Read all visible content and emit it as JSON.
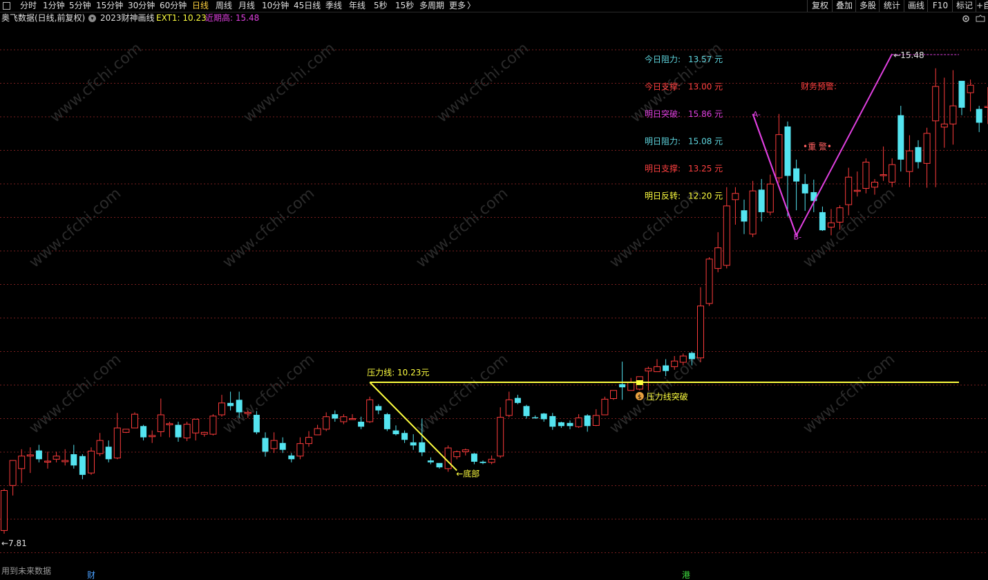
{
  "toolbar": {
    "periods": [
      "分时",
      "1分钟",
      "5分钟",
      "15分钟",
      "30分钟",
      "60分钟",
      "日线",
      "周线",
      "月线",
      "10分钟",
      "45日线",
      "季线",
      "年线",
      "5秒",
      "15秒",
      "多周期",
      "更多"
    ],
    "active_period": "日线",
    "more_arrow": "〉",
    "tools": [
      "复权",
      "叠加",
      "多股",
      "统计",
      "画线",
      "F10",
      "标记",
      "+自"
    ]
  },
  "info": {
    "stock": "奥飞数据(日线,前复权)",
    "indicator": "2023财神画线",
    "ext_label": "EXT1: 10.23",
    "recent_high_label": "近期高: 15.48"
  },
  "panel": {
    "rows": [
      {
        "label": "今日阻力:",
        "value": "13.57 元",
        "color": "#5fd7e0"
      },
      {
        "label": "今日支撑:",
        "value": "13.00 元",
        "color": "#ff4040"
      },
      {
        "label": "明日突破:",
        "value": "15.86 元",
        "color": "#e040e0"
      },
      {
        "label": "明日阻力:",
        "value": "15.08 元",
        "color": "#5fd7e0"
      },
      {
        "label": "明日支撑:",
        "value": "13.25 元",
        "color": "#ff4040"
      },
      {
        "label": "明日反转:",
        "value": "12.20 元",
        "color": "#ffff40"
      }
    ],
    "warning": "财务预警:",
    "alert": "•重 警•"
  },
  "annotations": {
    "pressure_line": "压力线: 10.23元",
    "bottom": "←底部",
    "breakthrough": "压力线突破",
    "low_label": "←7.81",
    "high_label": "←15.48",
    "point_a": "A-",
    "point_b": "B-",
    "coin": "$"
  },
  "footer": {
    "note": "用到未来数据",
    "marker_1": "财",
    "marker_2": "港"
  },
  "watermark": "www.cfchi.com",
  "colors": {
    "up": "#ff3c3c",
    "down": "#54e4f0",
    "grid": "#7a1f1f",
    "pressure": "#ffff40",
    "zigzag": "#e040e0"
  },
  "chart_data": {
    "type": "candlestick",
    "title": "奥飞数据(日线,前复权)",
    "ylim": [
      7.5,
      15.9
    ],
    "pressure_level": 10.23,
    "recent_high": 15.48,
    "low_marker": 7.81,
    "candles": [
      {
        "o": 7.86,
        "h": 8.53,
        "l": 7.81,
        "c": 8.5
      },
      {
        "o": 8.58,
        "h": 8.92,
        "l": 8.42,
        "c": 8.98
      },
      {
        "o": 8.85,
        "h": 9.16,
        "l": 8.62,
        "c": 9.05
      },
      {
        "o": 9.05,
        "h": 9.19,
        "l": 8.78,
        "c": 9.07
      },
      {
        "o": 9.14,
        "h": 9.23,
        "l": 8.95,
        "c": 9.0
      },
      {
        "o": 8.97,
        "h": 9.12,
        "l": 8.85,
        "c": 8.97
      },
      {
        "o": 9.0,
        "h": 9.12,
        "l": 8.95,
        "c": 9.05
      },
      {
        "o": 8.96,
        "h": 9.16,
        "l": 8.9,
        "c": 8.98
      },
      {
        "o": 9.08,
        "h": 9.23,
        "l": 8.85,
        "c": 8.9
      },
      {
        "o": 9.05,
        "h": 9.08,
        "l": 8.68,
        "c": 8.75
      },
      {
        "o": 8.78,
        "h": 9.19,
        "l": 8.75,
        "c": 9.13
      },
      {
        "o": 9.09,
        "h": 9.42,
        "l": 9.05,
        "c": 9.3
      },
      {
        "o": 9.2,
        "h": 9.3,
        "l": 8.95,
        "c": 9.0
      },
      {
        "o": 9.02,
        "h": 9.74,
        "l": 9.0,
        "c": 9.5
      },
      {
        "o": 9.43,
        "h": 9.48,
        "l": 9.42,
        "c": 9.48
      },
      {
        "o": 9.5,
        "h": 9.75,
        "l": 9.5,
        "c": 9.72
      },
      {
        "o": 9.53,
        "h": 9.55,
        "l": 9.3,
        "c": 9.35
      },
      {
        "o": 9.36,
        "h": 9.46,
        "l": 9.26,
        "c": 9.38
      },
      {
        "o": 9.44,
        "h": 9.97,
        "l": 9.36,
        "c": 9.71
      },
      {
        "o": 9.55,
        "h": 9.6,
        "l": 9.35,
        "c": 9.57
      },
      {
        "o": 9.55,
        "h": 9.6,
        "l": 9.28,
        "c": 9.35
      },
      {
        "o": 9.34,
        "h": 9.6,
        "l": 9.29,
        "c": 9.56
      },
      {
        "o": 9.42,
        "h": 9.64,
        "l": 9.3,
        "c": 9.64
      },
      {
        "o": 9.4,
        "h": 9.44,
        "l": 9.36,
        "c": 9.43
      },
      {
        "o": 9.4,
        "h": 9.72,
        "l": 9.38,
        "c": 9.69
      },
      {
        "o": 9.71,
        "h": 10.03,
        "l": 9.68,
        "c": 9.9
      },
      {
        "o": 9.9,
        "h": 10.08,
        "l": 9.78,
        "c": 9.85
      },
      {
        "o": 9.95,
        "h": 10.08,
        "l": 9.66,
        "c": 9.75
      },
      {
        "o": 9.73,
        "h": 9.78,
        "l": 9.66,
        "c": 9.75
      },
      {
        "o": 9.71,
        "h": 9.77,
        "l": 9.4,
        "c": 9.43
      },
      {
        "o": 9.34,
        "h": 9.43,
        "l": 9.04,
        "c": 9.12
      },
      {
        "o": 9.17,
        "h": 9.43,
        "l": 9.1,
        "c": 9.3
      },
      {
        "o": 9.26,
        "h": 9.35,
        "l": 9.1,
        "c": 9.15
      },
      {
        "o": 9.06,
        "h": 9.1,
        "l": 8.95,
        "c": 9.0
      },
      {
        "o": 9.05,
        "h": 9.35,
        "l": 9.0,
        "c": 9.25
      },
      {
        "o": 9.25,
        "h": 9.45,
        "l": 9.2,
        "c": 9.35
      },
      {
        "o": 9.39,
        "h": 9.55,
        "l": 9.39,
        "c": 9.49
      },
      {
        "o": 9.48,
        "h": 9.75,
        "l": 9.45,
        "c": 9.68
      },
      {
        "o": 9.72,
        "h": 9.78,
        "l": 9.6,
        "c": 9.65
      },
      {
        "o": 9.6,
        "h": 9.72,
        "l": 9.56,
        "c": 9.68
      },
      {
        "o": 9.65,
        "h": 9.72,
        "l": 9.63,
        "c": 9.65
      },
      {
        "o": 9.6,
        "h": 9.68,
        "l": 9.48,
        "c": 9.52
      },
      {
        "o": 9.6,
        "h": 10.0,
        "l": 9.58,
        "c": 9.95
      },
      {
        "o": 9.85,
        "h": 9.88,
        "l": 9.72,
        "c": 9.78
      },
      {
        "o": 9.72,
        "h": 9.74,
        "l": 9.45,
        "c": 9.48
      },
      {
        "o": 9.46,
        "h": 9.54,
        "l": 9.38,
        "c": 9.4
      },
      {
        "o": 9.42,
        "h": 9.46,
        "l": 9.26,
        "c": 9.31
      },
      {
        "o": 9.27,
        "h": 9.4,
        "l": 9.15,
        "c": 9.22
      },
      {
        "o": 9.27,
        "h": 9.65,
        "l": 9.05,
        "c": 9.11
      },
      {
        "o": 8.98,
        "h": 9.03,
        "l": 8.92,
        "c": 8.95
      },
      {
        "o": 8.94,
        "h": 8.92,
        "l": 8.85,
        "c": 8.87
      },
      {
        "o": 8.85,
        "h": 9.22,
        "l": 8.8,
        "c": 9.18
      },
      {
        "o": 9.04,
        "h": 9.14,
        "l": 9.0,
        "c": 9.12
      },
      {
        "o": 9.12,
        "h": 9.17,
        "l": 9.06,
        "c": 9.15
      },
      {
        "o": 9.09,
        "h": 9.1,
        "l": 8.92,
        "c": 8.96
      },
      {
        "o": 8.96,
        "h": 8.98,
        "l": 8.92,
        "c": 8.94
      },
      {
        "o": 8.95,
        "h": 9.06,
        "l": 8.92,
        "c": 9.0
      },
      {
        "o": 9.05,
        "h": 9.83,
        "l": 9.02,
        "c": 9.67
      },
      {
        "o": 9.7,
        "h": 10.08,
        "l": 9.67,
        "c": 9.95
      },
      {
        "o": 9.98,
        "h": 10.03,
        "l": 9.88,
        "c": 9.9
      },
      {
        "o": 9.85,
        "h": 9.87,
        "l": 9.65,
        "c": 9.69
      },
      {
        "o": 9.67,
        "h": 9.7,
        "l": 9.65,
        "c": 9.66
      },
      {
        "o": 9.73,
        "h": 9.74,
        "l": 9.6,
        "c": 9.64
      },
      {
        "o": 9.69,
        "h": 9.74,
        "l": 9.47,
        "c": 9.52
      },
      {
        "o": 9.59,
        "h": 9.6,
        "l": 9.5,
        "c": 9.53
      },
      {
        "o": 9.58,
        "h": 9.62,
        "l": 9.48,
        "c": 9.53
      },
      {
        "o": 9.52,
        "h": 9.72,
        "l": 9.5,
        "c": 9.66
      },
      {
        "o": 9.7,
        "h": 9.72,
        "l": 9.44,
        "c": 9.53
      },
      {
        "o": 9.54,
        "h": 9.8,
        "l": 9.53,
        "c": 9.7
      },
      {
        "o": 9.71,
        "h": 10.0,
        "l": 9.71,
        "c": 9.96
      },
      {
        "o": 9.97,
        "h": 10.1,
        "l": 9.95,
        "c": 10.1
      },
      {
        "o": 10.2,
        "h": 10.56,
        "l": 9.95,
        "c": 10.15
      },
      {
        "o": 10.1,
        "h": 10.3,
        "l": 10.1,
        "c": 10.23
      },
      {
        "o": 10.12,
        "h": 10.3,
        "l": 10.1,
        "c": 10.32
      },
      {
        "o": 10.41,
        "h": 10.48,
        "l": 10.1,
        "c": 10.45
      },
      {
        "o": 10.4,
        "h": 10.6,
        "l": 10.42,
        "c": 10.48
      },
      {
        "o": 10.5,
        "h": 10.6,
        "l": 10.33,
        "c": 10.41
      },
      {
        "o": 10.48,
        "h": 10.65,
        "l": 10.43,
        "c": 10.57
      },
      {
        "o": 10.55,
        "h": 10.69,
        "l": 10.5,
        "c": 10.65
      },
      {
        "o": 10.7,
        "h": 10.72,
        "l": 10.5,
        "c": 10.6
      },
      {
        "o": 10.62,
        "h": 11.75,
        "l": 10.55,
        "c": 11.45
      },
      {
        "o": 11.49,
        "h": 12.23,
        "l": 11.45,
        "c": 12.2
      },
      {
        "o": 12.05,
        "h": 12.63,
        "l": 11.99,
        "c": 12.38
      },
      {
        "o": 12.1,
        "h": 13.35,
        "l": 12.05,
        "c": 13.05
      },
      {
        "o": 13.15,
        "h": 13.35,
        "l": 12.75,
        "c": 13.25
      },
      {
        "o": 12.98,
        "h": 13.15,
        "l": 12.6,
        "c": 12.8
      },
      {
        "o": 12.6,
        "h": 13.45,
        "l": 12.55,
        "c": 13.29
      },
      {
        "o": 13.31,
        "h": 13.48,
        "l": 12.8,
        "c": 12.95
      },
      {
        "o": 12.95,
        "h": 13.55,
        "l": 12.9,
        "c": 13.4
      },
      {
        "o": 13.5,
        "h": 14.52,
        "l": 13.42,
        "c": 14.19
      },
      {
        "o": 14.32,
        "h": 14.4,
        "l": 12.88,
        "c": 13.53
      },
      {
        "o": 13.65,
        "h": 13.79,
        "l": 12.98,
        "c": 13.44
      },
      {
        "o": 13.4,
        "h": 13.56,
        "l": 12.97,
        "c": 13.25
      },
      {
        "o": 13.27,
        "h": 13.47,
        "l": 12.95,
        "c": 13.13
      },
      {
        "o": 12.95,
        "h": 13.04,
        "l": 12.65,
        "c": 12.66
      },
      {
        "o": 12.71,
        "h": 13.0,
        "l": 12.58,
        "c": 12.78
      },
      {
        "o": 12.79,
        "h": 13.06,
        "l": 12.67,
        "c": 13.02
      },
      {
        "o": 13.07,
        "h": 13.66,
        "l": 12.9,
        "c": 13.51
      },
      {
        "o": 13.3,
        "h": 13.6,
        "l": 13.2,
        "c": 13.3
      },
      {
        "o": 13.33,
        "h": 13.81,
        "l": 13.25,
        "c": 13.75
      },
      {
        "o": 13.35,
        "h": 13.48,
        "l": 13.23,
        "c": 13.43
      },
      {
        "o": 13.55,
        "h": 14.0,
        "l": 13.45,
        "c": 13.55
      },
      {
        "o": 13.43,
        "h": 13.81,
        "l": 13.35,
        "c": 13.71
      },
      {
        "o": 14.5,
        "h": 14.65,
        "l": 13.6,
        "c": 13.79
      },
      {
        "o": 13.6,
        "h": 14.18,
        "l": 13.35,
        "c": 13.93
      },
      {
        "o": 13.99,
        "h": 14.1,
        "l": 13.65,
        "c": 13.75
      },
      {
        "o": 13.73,
        "h": 14.3,
        "l": 13.34,
        "c": 14.21
      },
      {
        "o": 14.41,
        "h": 15.25,
        "l": 13.35,
        "c": 14.96
      },
      {
        "o": 14.31,
        "h": 15.1,
        "l": 13.98,
        "c": 14.36
      },
      {
        "o": 14.36,
        "h": 15.22,
        "l": 14.03,
        "c": 14.65
      },
      {
        "o": 15.05,
        "h": 14.95,
        "l": 14.5,
        "c": 14.62
      },
      {
        "o": 14.86,
        "h": 15.07,
        "l": 14.56,
        "c": 14.98
      },
      {
        "o": 14.6,
        "h": 14.65,
        "l": 14.23,
        "c": 14.38
      },
      {
        "o": 14.64,
        "h": 14.95,
        "l": 14.36,
        "c": 14.64
      },
      {
        "o": 14.6,
        "h": 15.08,
        "l": 14.43,
        "c": 14.98
      },
      {
        "o": 14.8,
        "h": 15.0,
        "l": 14.55,
        "c": 14.86
      },
      {
        "o": 14.7,
        "h": 14.69,
        "l": 13.98,
        "c": 14.37
      },
      {
        "o": 14.6,
        "h": 14.98,
        "l": 13.92,
        "c": 14.01
      },
      {
        "o": 13.98,
        "h": 14.48,
        "l": 13.89,
        "c": 14.17
      }
    ]
  }
}
